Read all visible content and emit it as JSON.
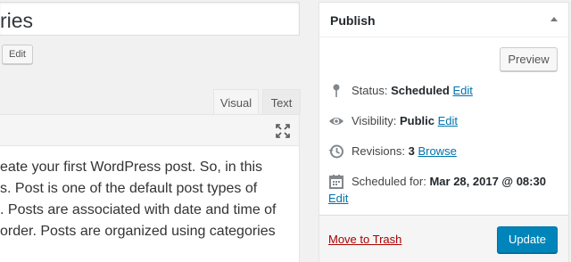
{
  "editor": {
    "title_value": "ries",
    "edit_slug_label": "Edit",
    "tabs": [
      {
        "label": "Visual"
      },
      {
        "label": "Text"
      }
    ],
    "content_lines": [
      "eate your first WordPress post. So, in this",
      "s. Post is one of the default post types of",
      ". Posts are associated with date and time of",
      "order. Posts are organized using categories"
    ]
  },
  "publish": {
    "title": "Publish",
    "preview_label": "Preview",
    "status_label": "Status:",
    "status_value": "Scheduled",
    "status_edit": "Edit",
    "visibility_label": "Visibility:",
    "visibility_value": "Public",
    "visibility_edit": "Edit",
    "revisions_label": "Revisions:",
    "revisions_count": "3",
    "revisions_browse": "Browse",
    "scheduled_label": "Scheduled for:",
    "scheduled_value": "Mar 28, 2017 @ 08:30",
    "scheduled_edit": "Edit",
    "trash_label": "Move to Trash",
    "update_label": "Update"
  },
  "colors": {
    "accent": "#0085ba",
    "link": "#0073aa",
    "trash": "#a00000"
  }
}
